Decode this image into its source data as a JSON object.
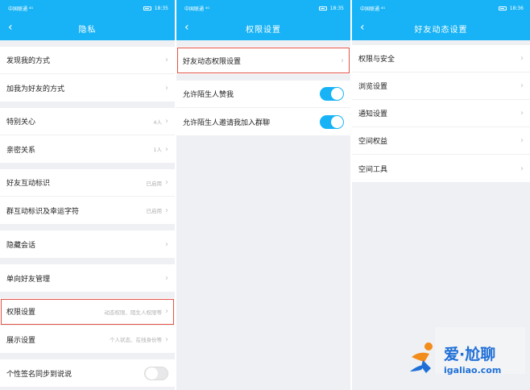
{
  "panels": [
    {
      "status": {
        "carrier": "中国联通 ⁴ᴳ",
        "time": "18:35"
      },
      "title": "隐私",
      "groups": [
        [
          {
            "label": "发现我的方式"
          },
          {
            "label": "加我为好友的方式"
          }
        ],
        [
          {
            "label": "特别关心",
            "value": "4人"
          },
          {
            "label": "亲密关系",
            "value": "1人"
          }
        ],
        [
          {
            "label": "好友互动标识",
            "value": "已启用"
          },
          {
            "label": "群互动标识及幸运字符",
            "value": "已启用"
          }
        ],
        [
          {
            "label": "隐藏会话"
          }
        ],
        [
          {
            "label": "单向好友管理"
          }
        ],
        [
          {
            "label": "权限设置",
            "value": "动态权限、陌生人权限等"
          },
          {
            "label": "展示设置",
            "value": "个人状态、在线身份等"
          }
        ],
        [
          {
            "label": "个性签名同步到说说",
            "toggle": false
          }
        ]
      ]
    },
    {
      "status": {
        "carrier": "中国联通 ⁴ᴳ",
        "time": "18:35"
      },
      "title": "权限设置",
      "groups": [
        [
          {
            "label": "好友动态权限设置"
          }
        ],
        [
          {
            "label": "允许陌生人赞我",
            "toggle": true
          },
          {
            "label": "允许陌生人邀请我加入群聊",
            "toggle": true
          }
        ]
      ]
    },
    {
      "status": {
        "carrier": "中国联通 ⁴ᴳ",
        "time": "18:36"
      },
      "title": "好友动态设置",
      "groups": [
        [
          {
            "label": "权限与安全"
          },
          {
            "label": "浏览设置"
          },
          {
            "label": "通知设置"
          },
          {
            "label": "空间权益"
          },
          {
            "label": "空间工具"
          }
        ]
      ]
    }
  ],
  "watermark": {
    "name": "爱·尬聊",
    "url": "igaliao.com"
  },
  "colors": {
    "accent": "#17b3f6",
    "highlight": "#e25247",
    "watermark": "#1f6fd6"
  }
}
